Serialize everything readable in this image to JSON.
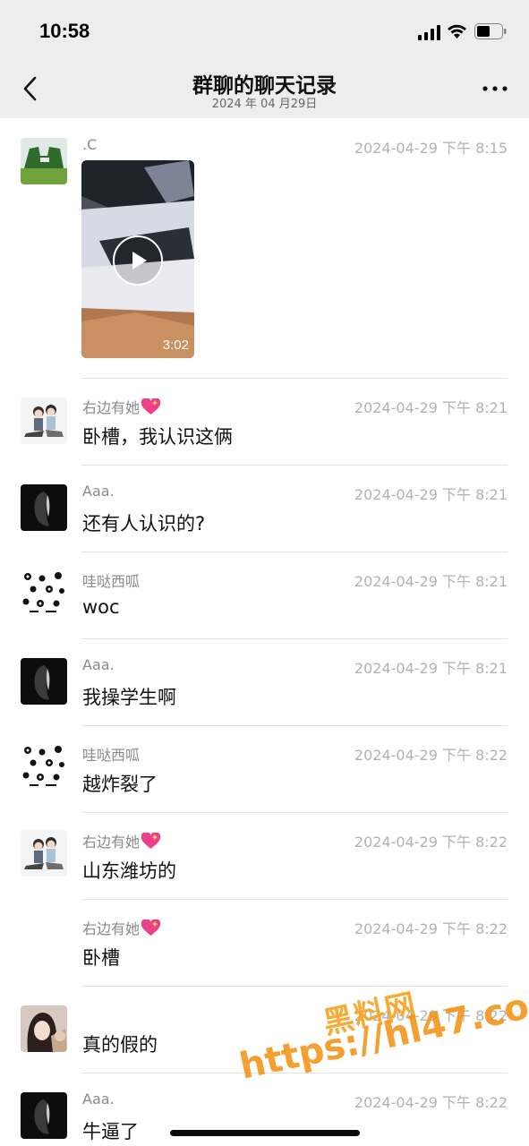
{
  "status_bar": {
    "time": "10:58"
  },
  "nav": {
    "title": "群聊的聊天记录",
    "subtitle": "2024 年 04 月29日"
  },
  "messages": [
    {
      "sender": ".C",
      "timestamp": "2024-04-29 下午 8:15",
      "text": "",
      "video_duration": "3:02",
      "has_heart": false,
      "avatar": "grass-field"
    },
    {
      "sender": "右边有她",
      "timestamp": "2024-04-29 下午 8:21",
      "text": "卧槽，我认识这俩",
      "has_heart": true,
      "avatar": "couple-cartoon"
    },
    {
      "sender": "Aaa.",
      "timestamp": "2024-04-29 下午 8:21",
      "text": "还有人认识的?",
      "has_heart": false,
      "avatar": "dark-portrait"
    },
    {
      "sender": "哇哒西呱",
      "timestamp": "2024-04-29 下午 8:21",
      "text": "woc",
      "has_heart": false,
      "avatar": "ha-pattern"
    },
    {
      "sender": "Aaa.",
      "timestamp": "2024-04-29 下午 8:21",
      "text": "我操学生啊",
      "has_heart": false,
      "avatar": "dark-portrait"
    },
    {
      "sender": "哇哒西呱",
      "timestamp": "2024-04-29 下午 8:22",
      "text": "越炸裂了",
      "has_heart": false,
      "avatar": "ha-pattern"
    },
    {
      "sender": "右边有她",
      "timestamp": "2024-04-29 下午 8:22",
      "text": "山东潍坊的",
      "has_heart": true,
      "avatar": "couple-cartoon"
    },
    {
      "sender": "右边有她",
      "timestamp": "2024-04-29 下午 8:22",
      "text": "卧槽",
      "has_heart": true,
      "avatar": ""
    },
    {
      "sender": "",
      "timestamp": "2024-04-29 下午 8:22",
      "text": "真的假的",
      "has_heart": false,
      "avatar": "girl-photo"
    },
    {
      "sender": "Aaa.",
      "timestamp": "2024-04-29 下午 8:22",
      "text": "牛逼了",
      "has_heart": false,
      "avatar": "dark-portrait"
    }
  ],
  "watermark": {
    "line1": "黑料网",
    "line2": "https://hl47.co"
  },
  "colors": {
    "nav_bg": "#ededed",
    "muted_text": "#8a8a8a",
    "timestamp_text": "#b2b2b2",
    "watermark": "#f4951a"
  }
}
